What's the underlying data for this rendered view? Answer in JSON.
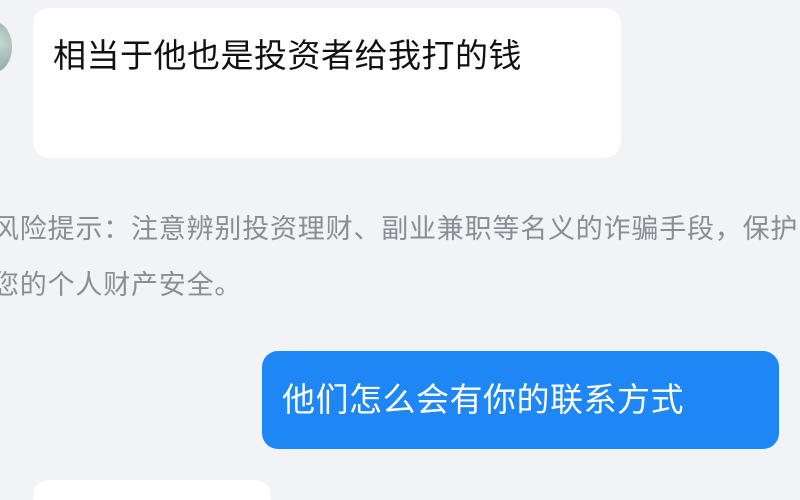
{
  "messages": {
    "incoming_1": {
      "text": "相当于他也是投资者给我打的钱"
    },
    "outgoing_1": {
      "text": "他们怎么会有你的联系方式"
    }
  },
  "system_notice": {
    "text": "风险提示：注意辨别投资理财、副业兼职等名义的诈骗手段，保护您的个人财产安全。"
  },
  "colors": {
    "background": "#f2f3f7",
    "incoming_bubble": "#ffffff",
    "outgoing_bubble": "#1e86f5",
    "notice_text": "#8a8d94"
  }
}
